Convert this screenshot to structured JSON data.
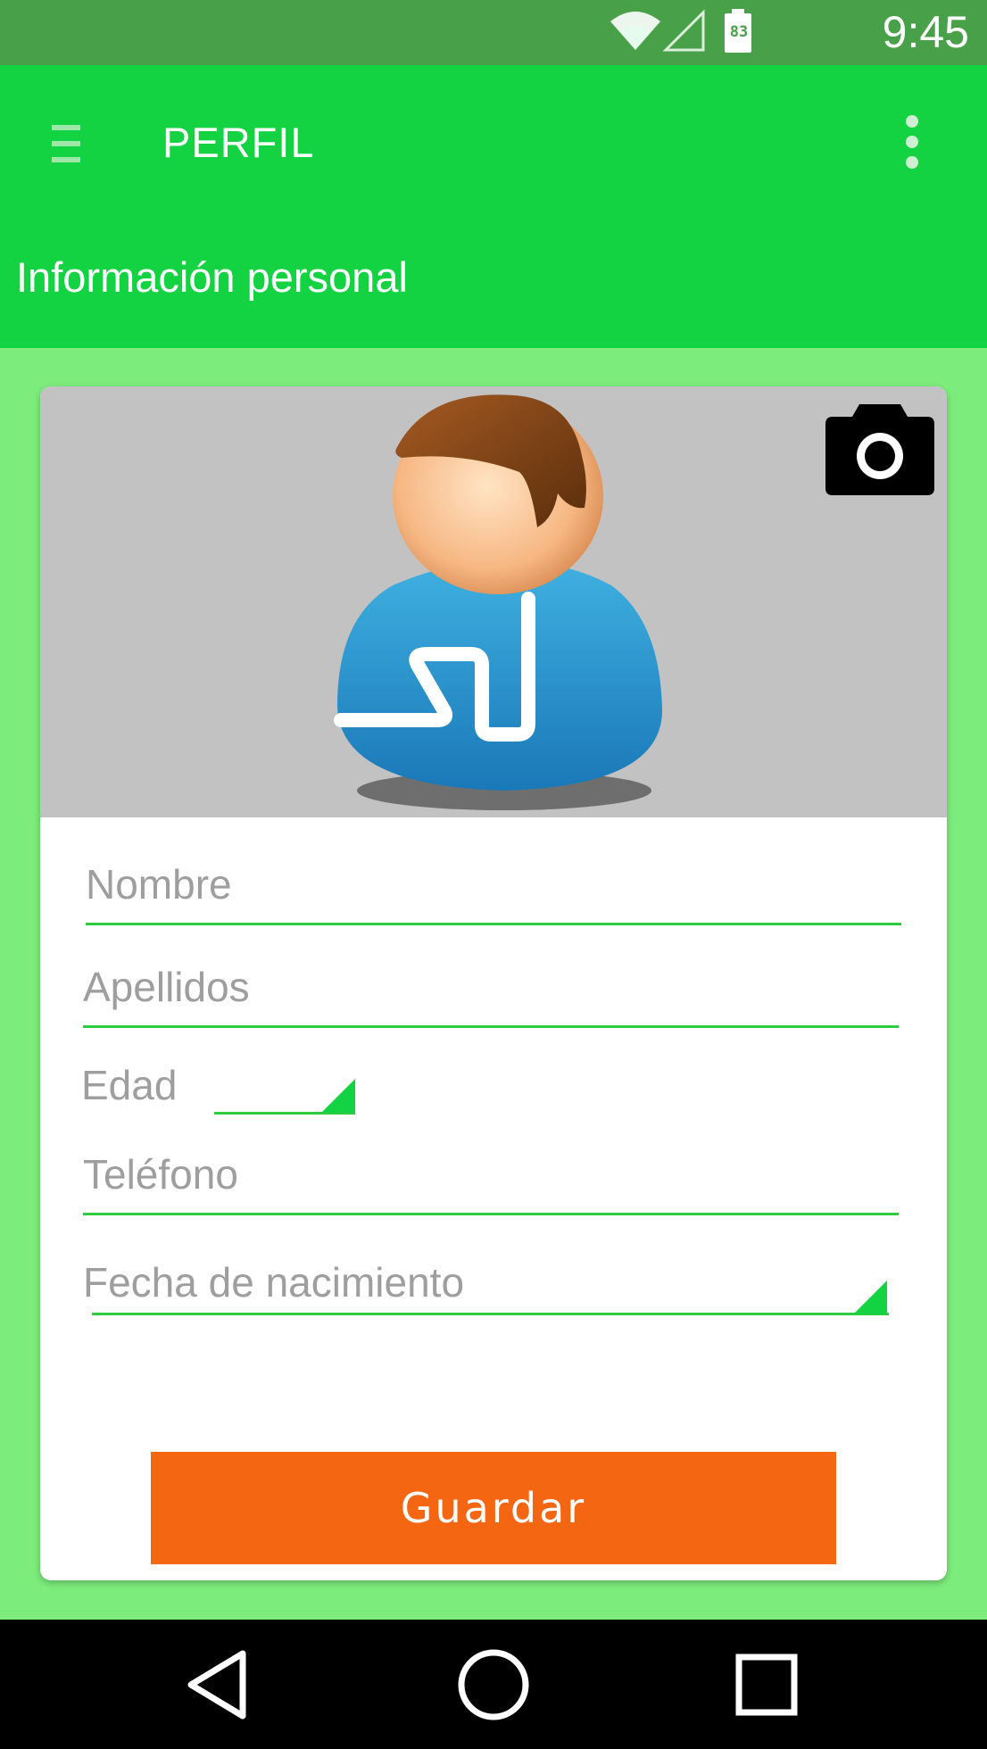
{
  "status_bar": {
    "time": "9:45",
    "battery_level": "83",
    "icons": [
      "wifi-icon",
      "cell-signal-icon",
      "battery-icon"
    ]
  },
  "app_bar": {
    "title": "PERFIL",
    "menu_icon": "hamburger-menu-icon",
    "overflow_icon": "more-vert-icon"
  },
  "section": {
    "title": "Información personal"
  },
  "profile": {
    "avatar_icon": "user-avatar-icon",
    "camera_icon": "camera-icon"
  },
  "form": {
    "nombre_label": "Nombre",
    "apellidos_label": "Apellidos",
    "edad_label": "Edad",
    "telefono_label": "Teléfono",
    "fecha_label": "Fecha de nacimiento"
  },
  "actions": {
    "save_label": "Guardar"
  },
  "colors": {
    "primary": "#13d343",
    "status_bar": "#48a048",
    "background": "#7ced7c",
    "accent": "#f56613",
    "field_line": "#2ecc40"
  },
  "nav_bar": {
    "icons": [
      "back-icon",
      "home-icon",
      "recents-icon"
    ]
  }
}
